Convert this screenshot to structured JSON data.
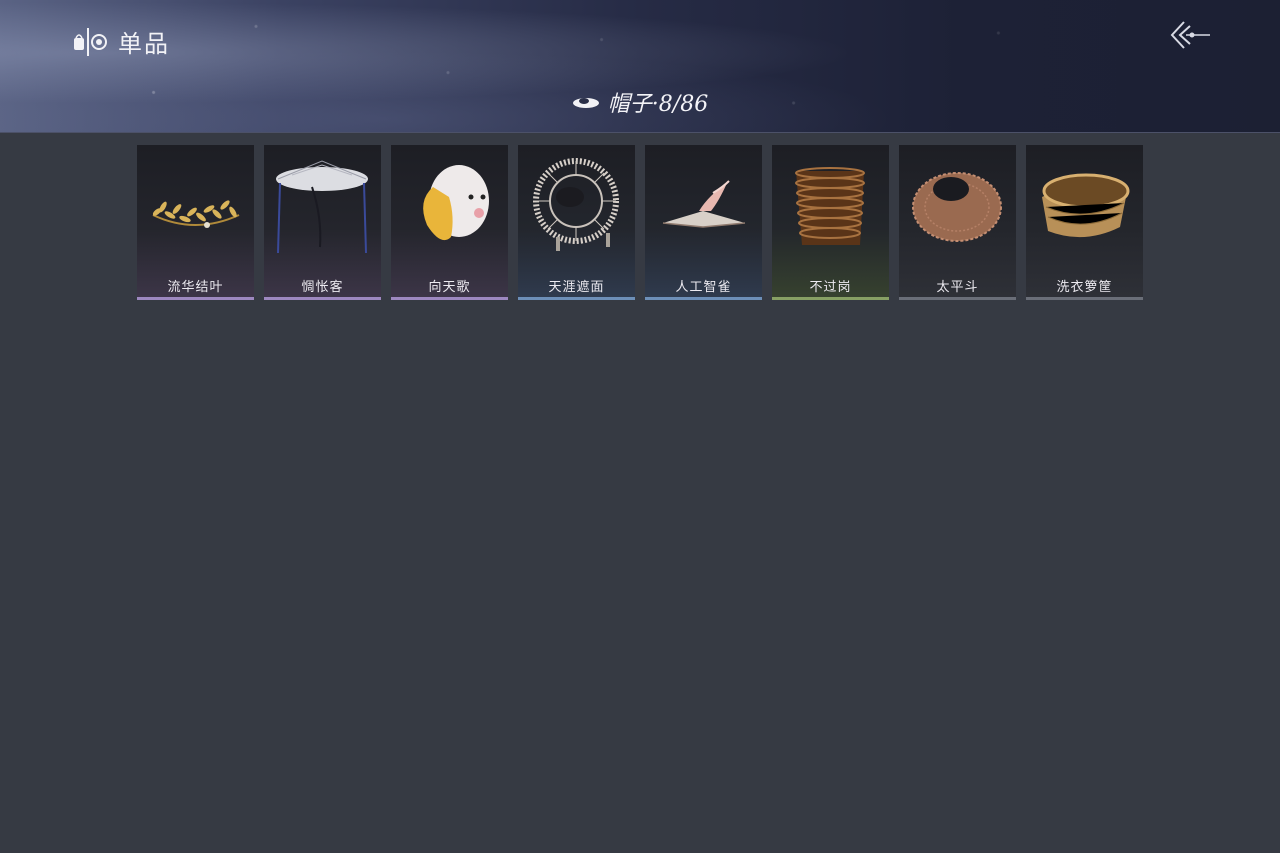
{
  "header": {
    "title": "单品",
    "logo_icon": "wardrobe-mirror-icon",
    "back_icon": "double-chevron-back-icon"
  },
  "category": {
    "icon": "hat-icon",
    "label": "帽子·8/86"
  },
  "colors": {
    "background": "#363a43",
    "purple_rarity": "#9d88c0",
    "blue_rarity": "#6d8fb8",
    "green_rarity": "#87a064"
  },
  "items": [
    {
      "name": "流华结叶",
      "rarity": "purple",
      "icon": "golden-leaf-crown-icon"
    },
    {
      "name": "惆怅客",
      "rarity": "purple",
      "icon": "veiled-bamboo-hat-icon"
    },
    {
      "name": "向天歌",
      "rarity": "purple",
      "icon": "duck-hood-icon"
    },
    {
      "name": "天涯遮面",
      "rarity": "blue",
      "icon": "wheel-rattan-hat-icon"
    },
    {
      "name": "人工智雀",
      "rarity": "blue",
      "icon": "bird-on-hat-icon"
    },
    {
      "name": "不过岗",
      "rarity": "green",
      "icon": "stacked-bowls-hat-icon"
    },
    {
      "name": "太平斗",
      "rarity": "plain",
      "icon": "wicker-basket-hat-icon"
    },
    {
      "name": "洗衣箩筐",
      "rarity": "plain",
      "icon": "laundry-basket-hat-icon"
    }
  ]
}
